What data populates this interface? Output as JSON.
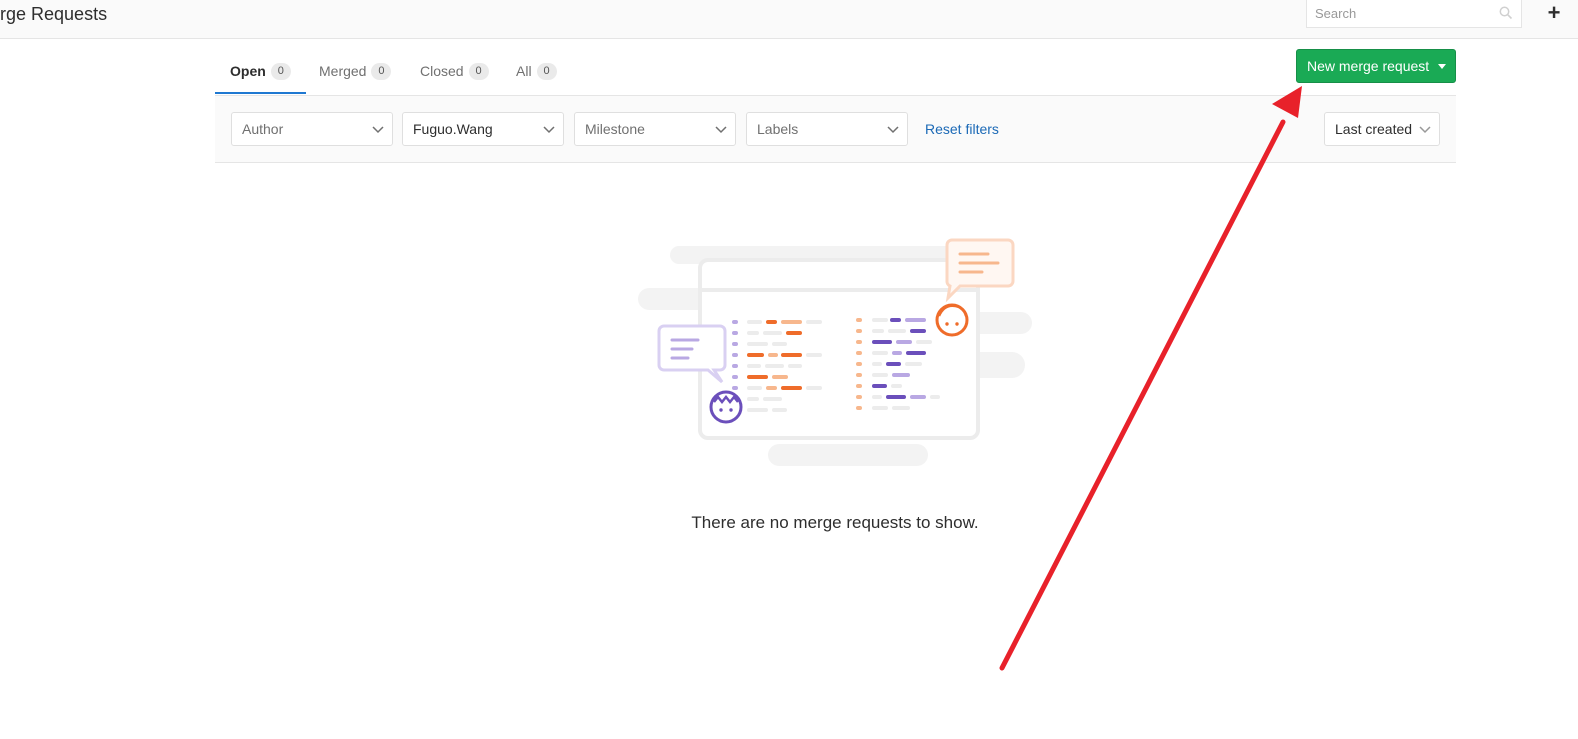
{
  "header": {
    "title": "erge Requests",
    "search_placeholder": "Search",
    "search_icon": "search-icon",
    "plus_icon": "plus-icon"
  },
  "tabs": [
    {
      "label": "Open",
      "count": "0",
      "active": true
    },
    {
      "label": "Merged",
      "count": "0",
      "active": false
    },
    {
      "label": "Closed",
      "count": "0",
      "active": false
    },
    {
      "label": "All",
      "count": "0",
      "active": false
    }
  ],
  "actions": {
    "new_merge_request": "New merge request"
  },
  "filters": {
    "author": "Author",
    "assignee": "Fuguo.Wang",
    "milestone": "Milestone",
    "labels": "Labels",
    "reset": "Reset filters",
    "sort": "Last created"
  },
  "empty_state": {
    "message": "There are no merge requests to show."
  },
  "colors": {
    "accent_blue": "#1f78d1",
    "button_green": "#1aaa55",
    "annotation_red": "#e8212a",
    "illustration_orange": "#ef6c2a",
    "illustration_purple": "#6b4fbb"
  }
}
